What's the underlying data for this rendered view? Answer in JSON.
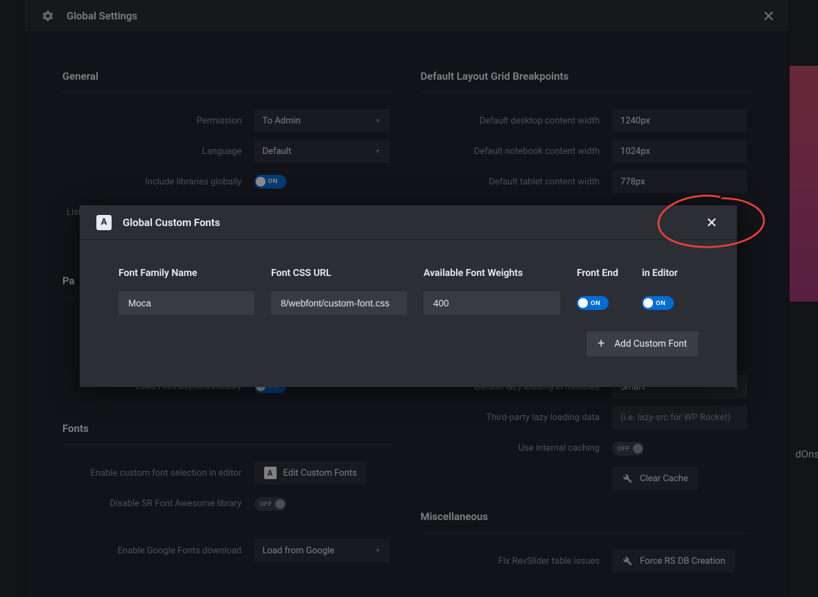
{
  "settings": {
    "title": "Global Settings",
    "sections": {
      "general": {
        "title": "General",
        "permission_label": "Permission",
        "permission_value": "To Admin",
        "language_label": "Language",
        "language_value": "Default",
        "include_libraries_label": "Include libraries globally",
        "include_libraries_state": "ON",
        "list_label_partial": "List"
      },
      "pa_partial": "Pa",
      "load_async_label": "Load Files asynchronously",
      "load_async_state": "ON",
      "fonts": {
        "title": "Fonts",
        "enable_custom_label": "Enable custom font selection in editor",
        "edit_custom_btn": "Edit Custom Fonts",
        "disable_fa_label": "Disable SR Font Awesome library",
        "disable_fa_state": "OFF",
        "enable_google_label": "Enable Google Fonts download",
        "google_value": "Load from Google"
      },
      "breakpoints": {
        "title": "Default Layout Grid Breakpoints",
        "desktop_label": "Default desktop content width",
        "desktop_value": "1240px",
        "notebook_label": "Default notebook content width",
        "notebook_value": "1024px",
        "tablet_label": "Default tablet content width",
        "tablet_value": "778px"
      },
      "lazy": {
        "default_lazy_label": "Default lazy loading in modules",
        "default_lazy_value": "Smart",
        "thirdparty_label": "Third-party lazy loading data",
        "thirdparty_value": "(i.e. lazy-src for WP Rocket)",
        "internal_cache_label": "Use internal caching",
        "internal_cache_state": "OFF",
        "clear_cache_btn": "Clear Cache"
      },
      "misc": {
        "title": "Miscellaneous",
        "fix_table_label": "Fix RevSlider table issues",
        "force_db_btn": "Force RS DB Creation"
      }
    }
  },
  "modal": {
    "title": "Global Custom Fonts",
    "fields": {
      "name_label": "Font Family Name",
      "name_value": "Moca",
      "css_label": "Font CSS URL",
      "css_value": "8/webfont/custom-font.css",
      "weights_label": "Available Font Weights",
      "weights_value": "400",
      "frontend_label": "Front End",
      "frontend_state": "ON",
      "editor_label": "in Editor",
      "editor_state": "ON"
    },
    "add_btn": "Add Custom Font"
  },
  "background_side_text": "dOns"
}
